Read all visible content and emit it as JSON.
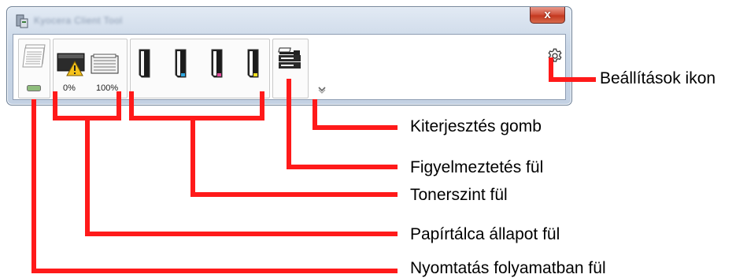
{
  "window": {
    "title": "Kyocera Client Tool",
    "close_label": "x"
  },
  "tabs": {
    "print_in_progress": {
      "icon": "print-stack-icon",
      "status_color": "#8ebc7c"
    },
    "paper_tray": {
      "tray_left_pct": "0%",
      "tray_right_pct": "100%",
      "warning_color": "#f5c21b"
    },
    "toner": {
      "colors": [
        "#1b1b1b",
        "#30a8e0",
        "#e24a9b",
        "#f3df1f"
      ]
    },
    "alert": {
      "icon": "printer-mfp-icon"
    }
  },
  "controls": {
    "expand_icon": "chevron-down-icon",
    "settings_icon": "gear-icon"
  },
  "callouts": {
    "settings": "Beállítások ikon",
    "expand": "Kiterjesztés gomb",
    "alert": "Figyelmeztetés fül",
    "toner": "Tonerszint fül",
    "paper": "Papírtálca állapot fül",
    "print": "Nyomtatás folyamatban fül"
  },
  "accent_colors": {
    "callout_line": "#ff1a1a"
  }
}
